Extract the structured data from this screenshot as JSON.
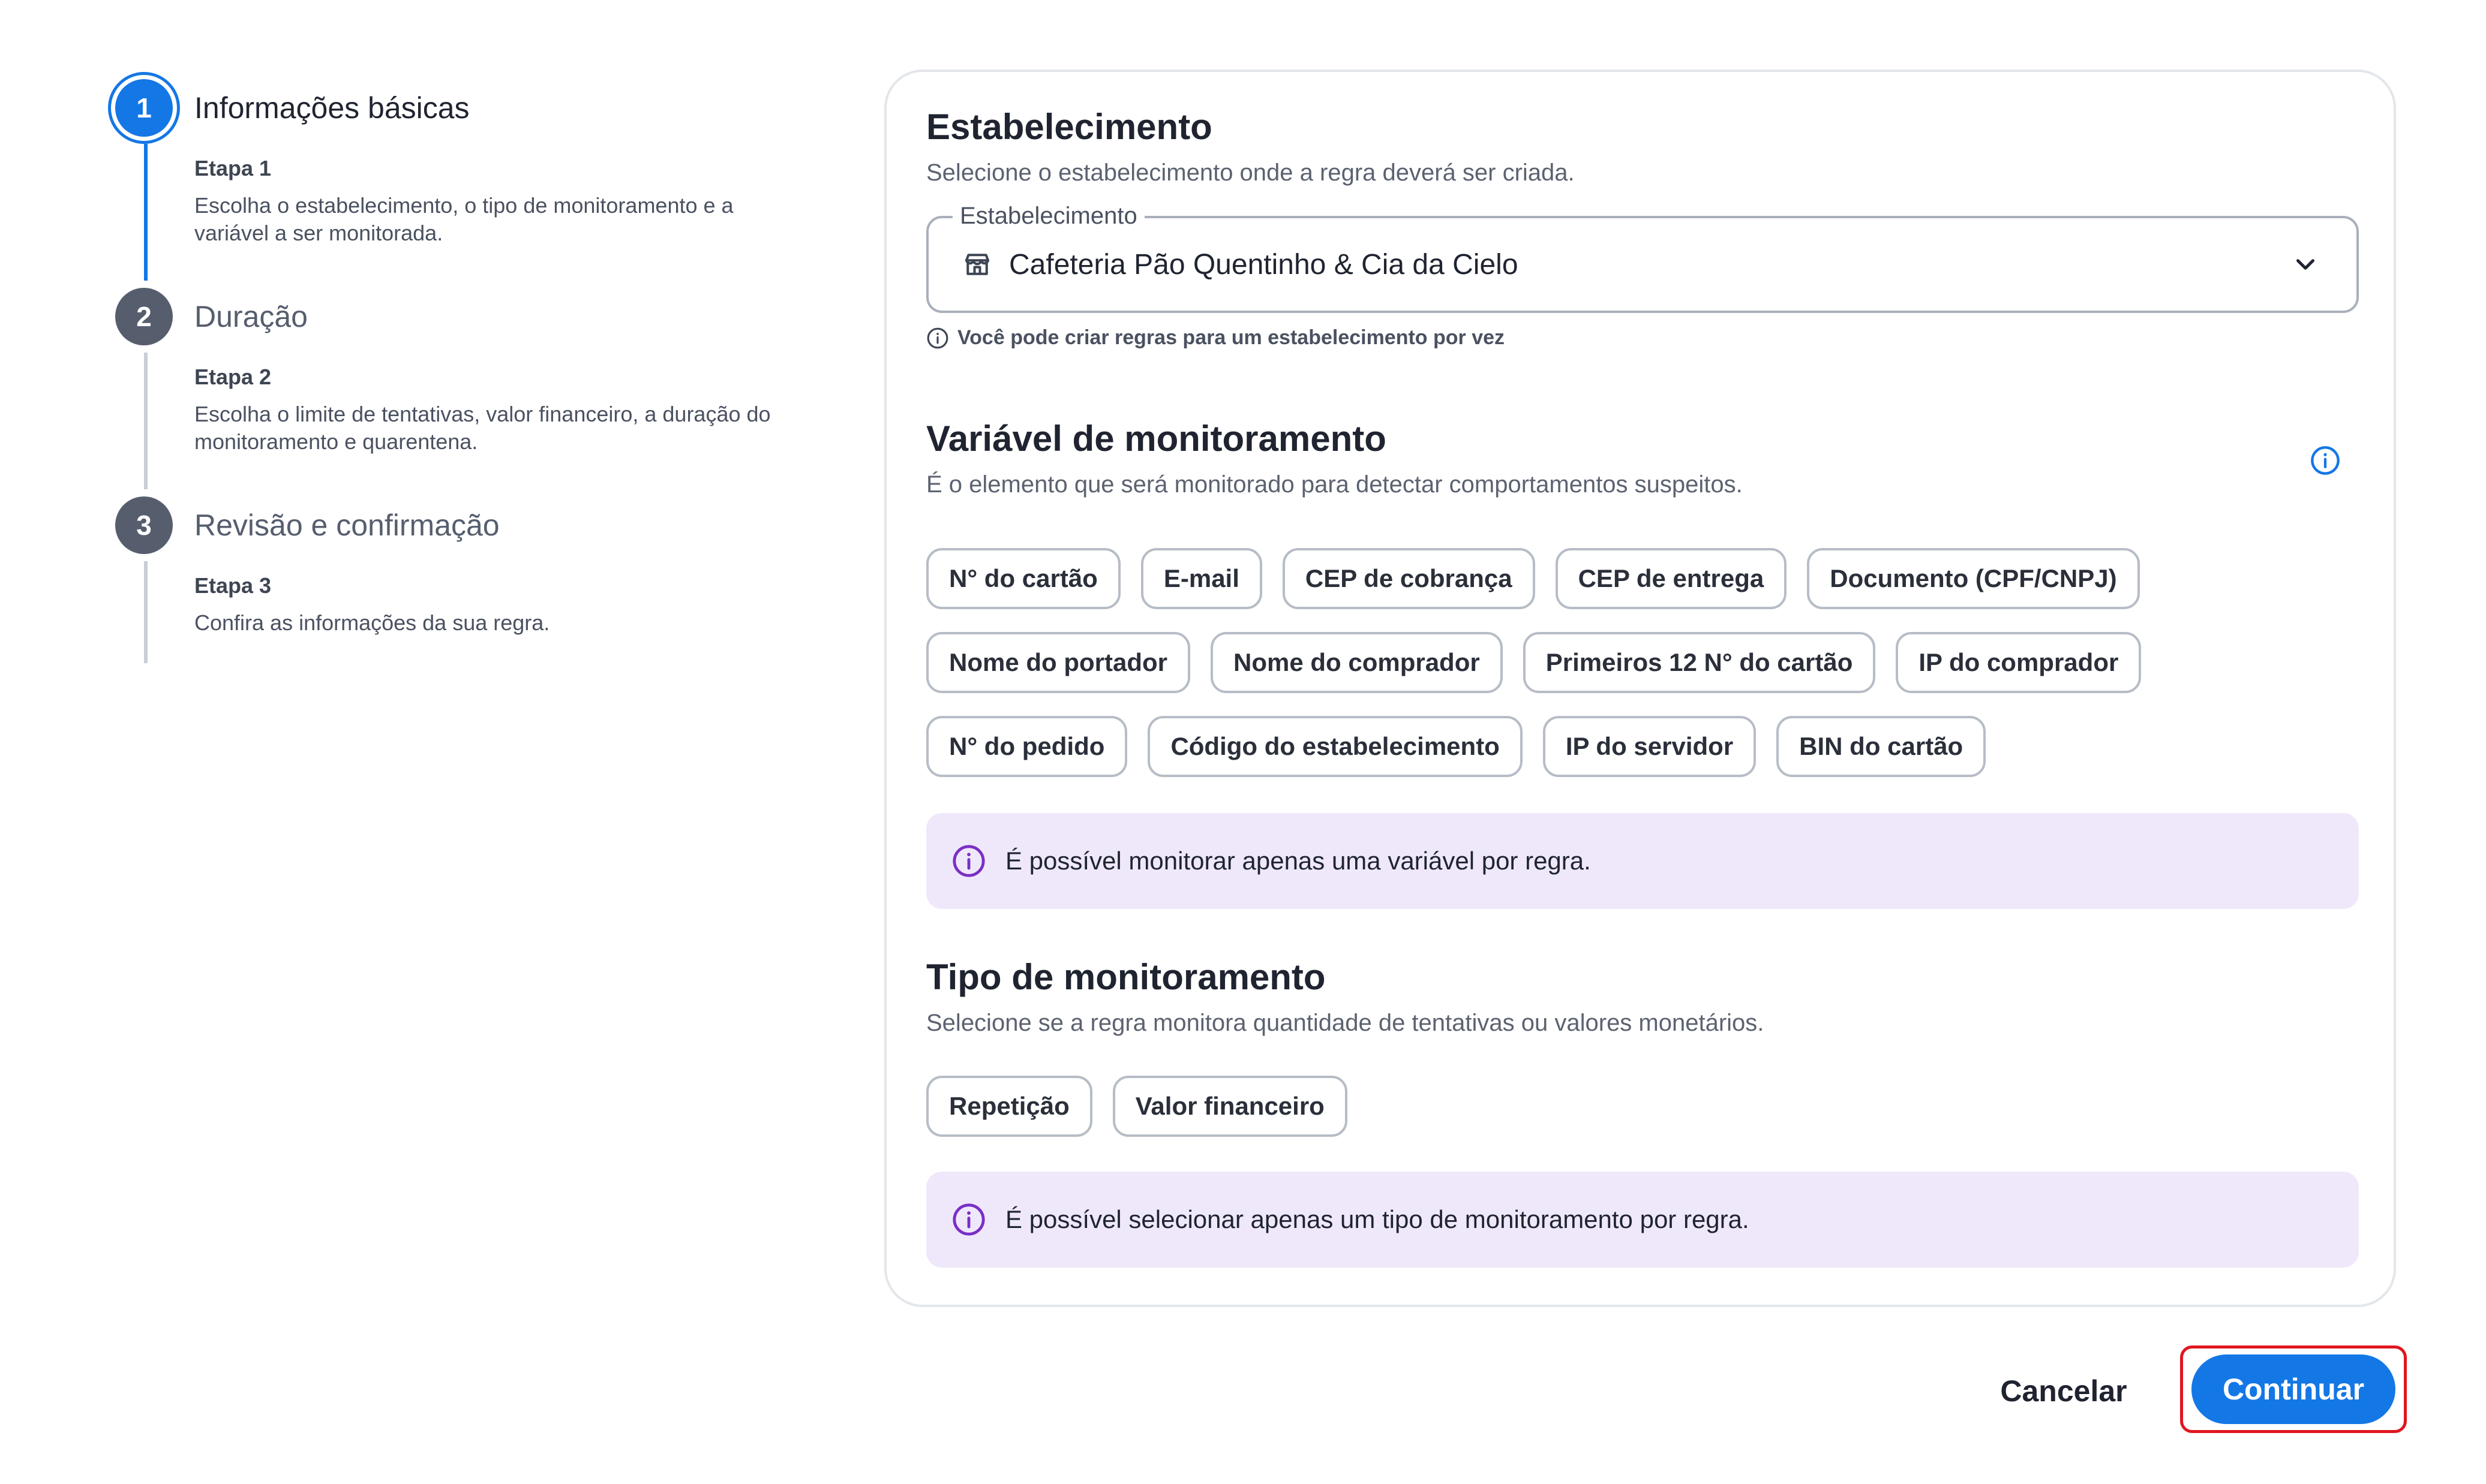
{
  "stepper": {
    "steps": [
      {
        "number": "1",
        "title": "Informações básicas",
        "label": "Etapa 1",
        "desc": "Escolha o estabelecimento, o tipo de monitoramento e a variável a ser monitorada.",
        "active": true
      },
      {
        "number": "2",
        "title": "Duração",
        "label": "Etapa 2",
        "desc": "Escolha o limite de tentativas, valor financeiro, a duração do monitoramento e quarentena.",
        "active": false
      },
      {
        "number": "3",
        "title": "Revisão e confirmação",
        "label": "Etapa 3",
        "desc": "Confira as informações da sua regra.",
        "active": false
      }
    ]
  },
  "establishment": {
    "title": "Estabelecimento",
    "subtitle": "Selecione o estabelecimento onde a regra deverá ser criada.",
    "field_label": "Estabelecimento",
    "selected_value": "Cafeteria Pão Quentinho & Cia da Cielo",
    "hint": "Você pode criar regras para um estabelecimento por vez"
  },
  "variable": {
    "title": "Variável de monitoramento",
    "subtitle": "É o elemento que será monitorado para detectar comportamentos suspeitos.",
    "chips": [
      "N° do cartão",
      "E-mail",
      "CEP de cobrança",
      "CEP de entrega",
      "Documento (CPF/CNPJ)",
      "Nome do portador",
      "Nome do comprador",
      "Primeiros 12 N° do cartão",
      "IP do comprador",
      "N° do pedido",
      "Código do estabelecimento",
      "IP do servidor",
      "BIN do cartão"
    ],
    "notice": "É possível monitorar apenas uma variável por regra."
  },
  "monitoring_type": {
    "title": "Tipo de monitoramento",
    "subtitle": "Selecione se a regra monitora quantidade de tentativas ou valores monetários.",
    "chips": [
      "Repetição",
      "Valor financeiro"
    ],
    "notice": "É possível selecionar apenas um tipo de monitoramento por regra."
  },
  "footer": {
    "cancel_label": "Cancelar",
    "continue_label": "Continuar"
  },
  "colors": {
    "primary": "#1477e6",
    "notice_bg": "#efe8fb",
    "notice_icon": "#7a2fc4",
    "highlight": "#e0161e"
  }
}
